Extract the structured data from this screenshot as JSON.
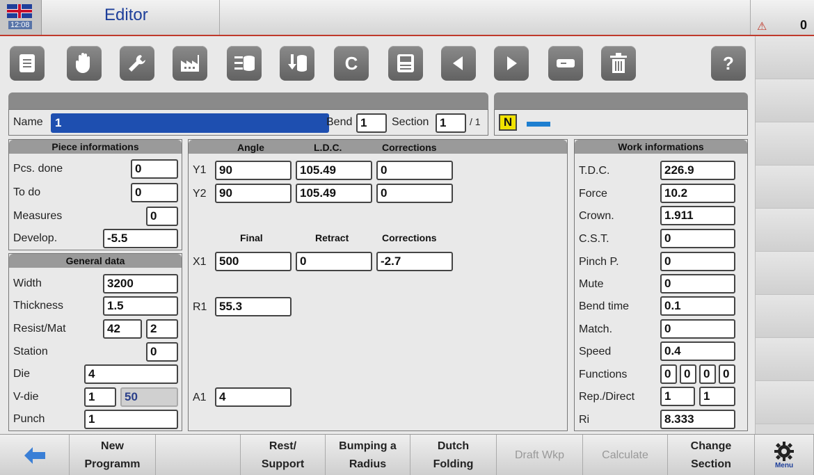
{
  "titlebar": {
    "time": "12:08",
    "title": "Editor",
    "counter": "0"
  },
  "toolbar": {
    "icons": [
      "document-icon",
      "hand-icon",
      "wrench-icon",
      "factory-icon",
      "database-list-icon",
      "database-import-icon",
      "clear-icon",
      "save-icon",
      "prev-icon",
      "next-icon",
      "minus-icon",
      "trash-icon",
      "help-icon"
    ],
    "clear_glyph": "C",
    "help_glyph": "?"
  },
  "header": {
    "name_label": "Name",
    "name_value": "1",
    "bend_label": "Bend",
    "bend_value": "1",
    "section_label": "Section",
    "section_value": "1",
    "section_total": "/ 1",
    "mode_badge": "N"
  },
  "piece": {
    "title": "Piece informations",
    "rows": [
      {
        "label": "Pcs. done",
        "value": "0"
      },
      {
        "label": "To do",
        "value": "0"
      },
      {
        "label": "Measures",
        "value": "0"
      },
      {
        "label": "Develop.",
        "value": "-5.5"
      }
    ]
  },
  "general": {
    "title": "General data",
    "rows": [
      {
        "label": "Width",
        "value": "3200"
      },
      {
        "label": "Thickness",
        "value": "1.5"
      },
      {
        "label": "Resist/Mat",
        "value": "42",
        "value2": "2"
      },
      {
        "label": "Station",
        "value": "0"
      },
      {
        "label": "Die",
        "value": "4"
      },
      {
        "label": "V-die",
        "value": "1",
        "value2": "50"
      },
      {
        "label": "Punch",
        "value": "1"
      }
    ]
  },
  "axes": {
    "h1": [
      "Angle",
      "L.D.C.",
      "Corrections"
    ],
    "y1": {
      "label": "Y1",
      "angle": "90",
      "ldc": "105.49",
      "corr": "0"
    },
    "y2": {
      "label": "Y2",
      "angle": "90",
      "ldc": "105.49",
      "corr": "0"
    },
    "h2": [
      "Final",
      "Retract",
      "Corrections"
    ],
    "x1": {
      "label": "X1",
      "final": "500",
      "retract": "0",
      "corr": "-2.7"
    },
    "r1": {
      "label": "R1",
      "value": "55.3"
    },
    "a1": {
      "label": "A1",
      "value": "4"
    }
  },
  "work": {
    "title": "Work informations",
    "rows": [
      {
        "label": "T.D.C.",
        "value": "226.9"
      },
      {
        "label": "Force",
        "value": "10.2"
      },
      {
        "label": "Crown.",
        "value": "1.911"
      },
      {
        "label": "C.S.T.",
        "value": "0"
      },
      {
        "label": "Pinch P.",
        "value": "0"
      },
      {
        "label": "Mute",
        "value": "0"
      },
      {
        "label": "Bend time",
        "value": "0.1"
      },
      {
        "label": "Match.",
        "value": "0"
      },
      {
        "label": "Speed",
        "value": "0.4"
      },
      {
        "label": "Functions",
        "values": [
          "0",
          "0",
          "0",
          "0"
        ]
      },
      {
        "label": "Rep./Direct",
        "value": "1",
        "value2": "1"
      },
      {
        "label": "Ri",
        "value": "8.333"
      }
    ]
  },
  "bottom": {
    "new_programm": "New\nProgramm",
    "rest_support": "Rest/\nSupport",
    "bumping": "Bumping a\nRadius",
    "dutch": "Dutch\nFolding",
    "draft": "Draft Wkp",
    "calculate": "Calculate",
    "change_section": "Change\nSection",
    "menu": "Menu"
  },
  "colors": {
    "accent": "#1e3f9a",
    "name_field": "#1e4fb0",
    "badge": "#f1e200",
    "red_line": "#c0392b"
  }
}
